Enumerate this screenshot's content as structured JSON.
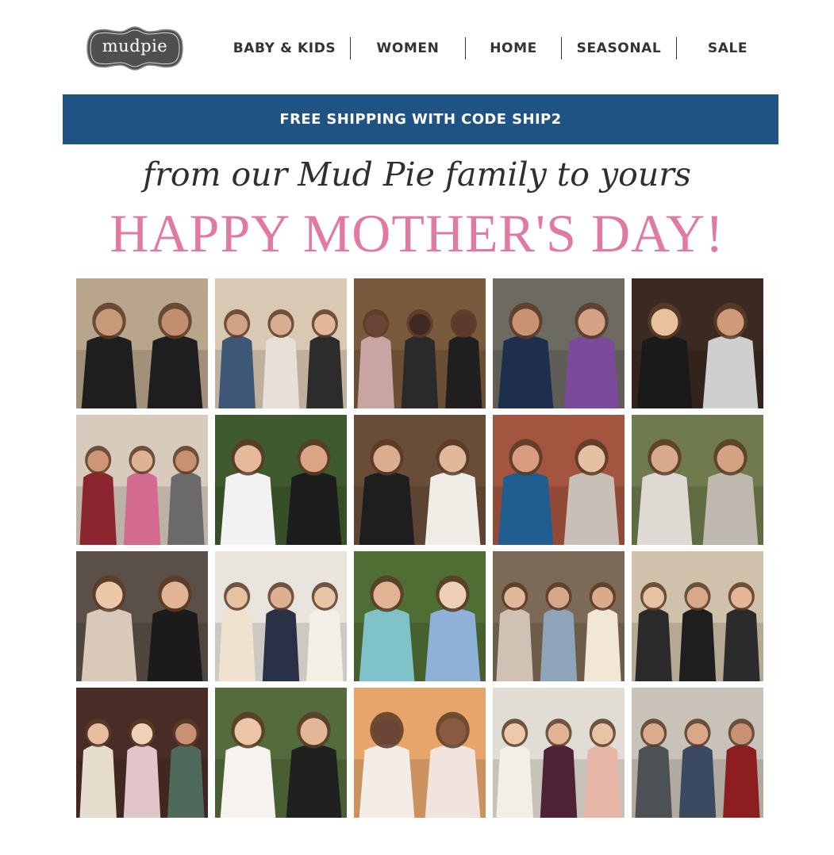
{
  "logo": {
    "text": "mudpie"
  },
  "nav": {
    "items": [
      "BABY & KIDS",
      "WOMEN",
      "HOME",
      "SEASONAL",
      "SALE"
    ]
  },
  "banner": {
    "text": "FREE SHIPPING WITH CODE SHIP2"
  },
  "hero": {
    "script": "from our Mud Pie family to yours",
    "headline": "HAPPY MOTHER'S DAY!"
  },
  "colors": {
    "banner_bg": "#1e5383",
    "headline": "#e07aa2",
    "nav_text": "#333333"
  },
  "photos": [
    {
      "name": "photo-runners",
      "bg": "#b9a48c",
      "people": [
        [
          "#1e1e1e",
          "#c99a7a"
        ],
        [
          "#1e1e1e",
          "#c28f70"
        ]
      ]
    },
    {
      "name": "photo-three-women-balloons",
      "bg": "#d9c9b3",
      "people": [
        [
          "#3d5876",
          "#d2a285"
        ],
        [
          "#e8e0d6",
          "#d8ae90"
        ],
        [
          "#2c2c2c",
          "#e2b79a"
        ]
      ]
    },
    {
      "name": "photo-family-selfie",
      "bg": "#7a5a3d",
      "people": [
        [
          "#c8a5a0",
          "#6b4535"
        ],
        [
          "#2a2a2a",
          "#3f2a22"
        ],
        [
          "#1f1f1f",
          "#5a3a2c"
        ]
      ]
    },
    {
      "name": "photo-two-women-street",
      "bg": "#6d6a62",
      "people": [
        [
          "#1e2f4d",
          "#c99274"
        ],
        [
          "#7b4a9a",
          "#d6a286"
        ]
      ]
    },
    {
      "name": "photo-two-women-door",
      "bg": "#3a2a22",
      "people": [
        [
          "#1a1a1a",
          "#e8c19f"
        ],
        [
          "#cfcfcf",
          "#cf9b7b"
        ]
      ]
    },
    {
      "name": "photo-women-with-kids",
      "bg": "#d8cbbd",
      "people": [
        [
          "#8b2630",
          "#cf9574"
        ],
        [
          "#d26b8f",
          "#e0b294"
        ],
        [
          "#6a6a6a",
          "#c99072"
        ]
      ]
    },
    {
      "name": "photo-selfie-two-women",
      "bg": "#3e5a2e",
      "people": [
        [
          "#f2f2f2",
          "#e5b99a"
        ],
        [
          "#1d1d1d",
          "#d9a584"
        ]
      ]
    },
    {
      "name": "photo-two-women-dress",
      "bg": "#6a4d38",
      "people": [
        [
          "#1e1e1e",
          "#d9ad8d"
        ],
        [
          "#f0ece6",
          "#e1b89a"
        ]
      ]
    },
    {
      "name": "photo-two-women-restaurant",
      "bg": "#a4553f",
      "people": [
        [
          "#1f5e8f",
          "#d99c7e"
        ],
        [
          "#c9bfb6",
          "#e6c1a1"
        ]
      ]
    },
    {
      "name": "photo-two-women-field",
      "bg": "#6f7a4d",
      "people": [
        [
          "#dedad3",
          "#d8a98a"
        ],
        [
          "#bfb8ae",
          "#d3a283"
        ]
      ]
    },
    {
      "name": "photo-close-selfie",
      "bg": "#5a5048",
      "people": [
        [
          "#d8c9b8",
          "#ecc8a9"
        ],
        [
          "#1b1b1b",
          "#e2b494"
        ]
      ]
    },
    {
      "name": "photo-three-women-white",
      "bg": "#e9e4dd",
      "people": [
        [
          "#efe3cf",
          "#e6c1a2"
        ],
        [
          "#2a3045",
          "#dcb090"
        ],
        [
          "#f4efe6",
          "#e8c6a6"
        ]
      ]
    },
    {
      "name": "photo-woman-with-baby",
      "bg": "#4f6e34",
      "people": [
        [
          "#7fc2c8",
          "#e2b494"
        ],
        [
          "#8fb1d8",
          "#efd0b6"
        ]
      ]
    },
    {
      "name": "photo-three-women-indoor",
      "bg": "#7c6a56",
      "people": [
        [
          "#cfc2b4",
          "#e1b89a"
        ],
        [
          "#8ea4b8",
          "#d7a78a"
        ],
        [
          "#f2e7d4",
          "#d9ab8a"
        ]
      ]
    },
    {
      "name": "photo-three-women-aprons",
      "bg": "#cfc1aa",
      "people": [
        [
          "#2a2a2a",
          "#e8c3a3"
        ],
        [
          "#1e1e1e",
          "#d8a987"
        ],
        [
          "#2b2b2b",
          "#e3b797"
        ]
      ]
    },
    {
      "name": "photo-christmas-family",
      "bg": "#4a2c27",
      "people": [
        [
          "#e6dccd",
          "#e6bd9e"
        ],
        [
          "#e0c6c9",
          "#efd0b8"
        ],
        [
          "#4d6a5a",
          "#c99173"
        ]
      ]
    },
    {
      "name": "photo-bride-and-mother",
      "bg": "#546b3b",
      "people": [
        [
          "#f6f3ee",
          "#ecc6a6"
        ],
        [
          "#202020",
          "#e2b797"
        ]
      ]
    },
    {
      "name": "photo-mother-daughter-smile",
      "bg": "#e7a56c",
      "people": [
        [
          "#f3ece7",
          "#6b4636"
        ],
        [
          "#f1e3dd",
          "#8a5a42"
        ]
      ]
    },
    {
      "name": "photo-wedding-three",
      "bg": "#e2ddd4",
      "people": [
        [
          "#f3efe8",
          "#ebc9aa"
        ],
        [
          "#4d2234",
          "#e1b392"
        ],
        [
          "#e8b6a9",
          "#e8c3a4"
        ]
      ]
    },
    {
      "name": "photo-group-shirts",
      "bg": "#c9c2b8",
      "people": [
        [
          "#4d5054",
          "#dcad8d"
        ],
        [
          "#3b4a5e",
          "#d8a889"
        ],
        [
          "#8c1e22",
          "#c99274"
        ]
      ]
    }
  ]
}
